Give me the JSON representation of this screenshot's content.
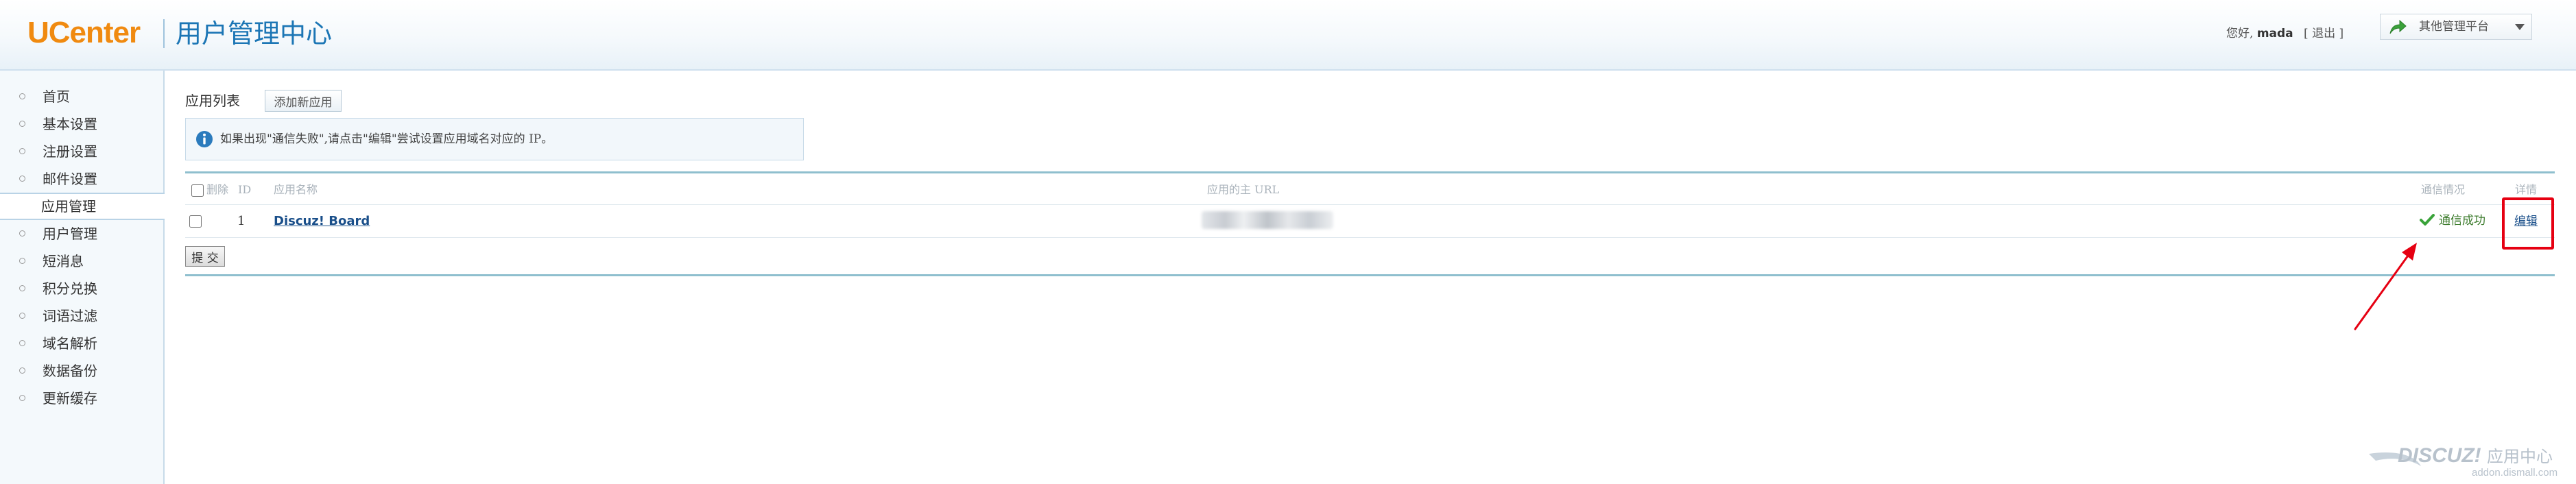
{
  "header": {
    "logo": "UCenter",
    "title": "用户管理中心",
    "greeting": "您好,",
    "username": "mada",
    "logout": "[ 退出 ]",
    "platform_select": "其他管理平台"
  },
  "sidebar": {
    "items": [
      {
        "label": "首页"
      },
      {
        "label": "基本设置"
      },
      {
        "label": "注册设置"
      },
      {
        "label": "邮件设置"
      },
      {
        "label": "应用管理",
        "active": true
      },
      {
        "label": "用户管理"
      },
      {
        "label": "短消息"
      },
      {
        "label": "积分兑换"
      },
      {
        "label": "词语过滤"
      },
      {
        "label": "域名解析"
      },
      {
        "label": "数据备份"
      },
      {
        "label": "更新缓存"
      }
    ]
  },
  "main": {
    "title": "应用列表",
    "add_button": "添加新应用",
    "notice": "如果出现\"通信失败\",请点击\"编辑\"尝试设置应用域名对应的 IP。",
    "table": {
      "headers": {
        "delete": "删除",
        "id": "ID",
        "name": "应用名称",
        "url": "应用的主 URL",
        "status": "通信情况",
        "detail": "详情"
      },
      "rows": [
        {
          "id": "1",
          "name": "Discuz! Board",
          "status": "通信成功",
          "edit": "编辑"
        }
      ]
    },
    "submit_button": "提 交"
  },
  "colors": {
    "logo": "#f08a10",
    "title_blue": "#1c76b5",
    "link": "#1a4f8a",
    "success": "#3a7a2a",
    "annotation_red": "#e60012"
  },
  "watermark": {
    "brand": "DISCUZ!",
    "suffix": "应用中心",
    "domain": "addon.dismall.com"
  }
}
